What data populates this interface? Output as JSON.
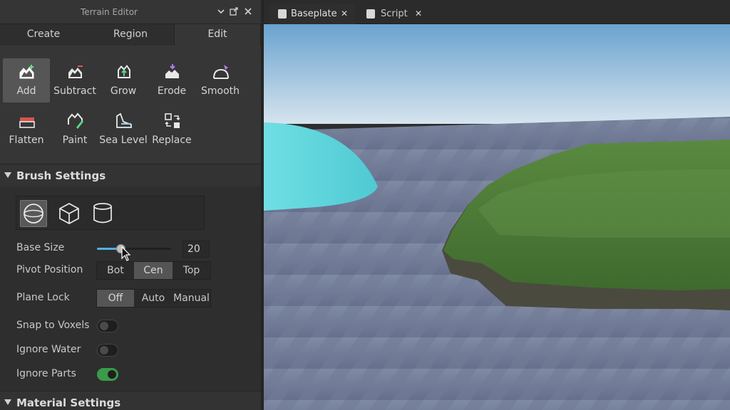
{
  "panel": {
    "title": "Terrain Editor",
    "controls": {
      "collapse_icon": "chevron-down-icon",
      "popout_icon": "popout-icon",
      "close_icon": "close-icon"
    },
    "mode_tabs": [
      {
        "label": "Create",
        "active": false
      },
      {
        "label": "Region",
        "active": false
      },
      {
        "label": "Edit",
        "active": true
      }
    ],
    "tools": [
      {
        "label": "Add",
        "icon": "terrain-add-icon",
        "selected": true
      },
      {
        "label": "Subtract",
        "icon": "terrain-subtract-icon",
        "selected": false
      },
      {
        "label": "Grow",
        "icon": "terrain-grow-icon",
        "selected": false
      },
      {
        "label": "Erode",
        "icon": "terrain-erode-icon",
        "selected": false
      },
      {
        "label": "Smooth",
        "icon": "terrain-smooth-icon",
        "selected": false
      },
      {
        "label": "Flatten",
        "icon": "terrain-flatten-icon",
        "selected": false
      },
      {
        "label": "Paint",
        "icon": "terrain-paint-icon",
        "selected": false
      },
      {
        "label": "Sea Level",
        "icon": "terrain-sea-level-icon",
        "selected": false
      },
      {
        "label": "Replace",
        "icon": "terrain-replace-icon",
        "selected": false
      }
    ],
    "brush_settings": {
      "header": "Brush Settings",
      "shapes": [
        {
          "icon": "sphere-icon",
          "active": true
        },
        {
          "icon": "cube-icon",
          "active": false
        },
        {
          "icon": "cylinder-icon",
          "active": false
        }
      ],
      "base_size": {
        "label": "Base Size",
        "value": "20",
        "fraction": 0.32
      },
      "pivot_position": {
        "label": "Pivot Position",
        "options": [
          "Bot",
          "Cen",
          "Top"
        ],
        "selected": "Cen"
      },
      "plane_lock": {
        "label": "Plane Lock",
        "options": [
          "Off",
          "Auto",
          "Manual"
        ],
        "selected": "Off"
      },
      "snap_to_voxels": {
        "label": "Snap to Voxels",
        "on": false
      },
      "ignore_water": {
        "label": "Ignore Water",
        "on": false
      },
      "ignore_parts": {
        "label": "Ignore Parts",
        "on": true
      }
    },
    "material_settings": {
      "header": "Material Settings"
    }
  },
  "editor_tabs": [
    {
      "label": "Baseplate",
      "icon": "place-icon",
      "active": true
    },
    {
      "label": "Script",
      "icon": "script-icon",
      "active": false
    }
  ],
  "colors": {
    "accent_blue": "#4fb1e8",
    "toggle_on": "#3a9b4a",
    "brush_preview": "#5fd6dc",
    "grass": "#4f7a3a"
  }
}
